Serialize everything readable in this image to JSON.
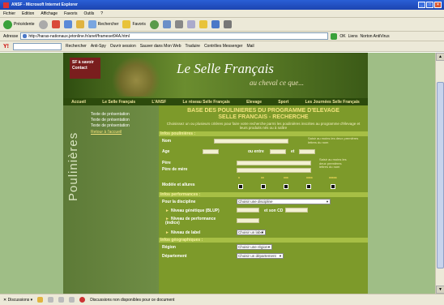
{
  "window": {
    "title": "ANSF - Microsoft Internet Explorer"
  },
  "menu": [
    "Fichier",
    "Edition",
    "Affichage",
    "Favoris",
    "Outils",
    "?"
  ],
  "toolbar": {
    "back": "Précédente",
    "search": "Rechercher",
    "favorites": "Favoris"
  },
  "address": {
    "label": "Adresse",
    "url": "http://haras-nationaux.jetonline.fr/anef/frameset94A.html",
    "go": "OK",
    "links": "Liens",
    "norton": "Norton AntiVirus"
  },
  "linksbar": {
    "search": "Rechercher",
    "antispy": "Anti-Spy",
    "session": "Ouvrir session",
    "save": "Sauver dans Mon Web",
    "translate": "Traduire",
    "parental": "Contrôles Messenger",
    "mail": "Mail"
  },
  "site": {
    "brand_tag": "SF à savoir",
    "contact": "Contact",
    "logo": "Le Selle Français",
    "tagline": "au cheval ce que...",
    "nav": [
      "Accueil",
      "Le Selle Français",
      "L'ANSF",
      "Le réseau Selle Français",
      "Elevage",
      "Sport",
      "Les Journées Selle Français"
    ],
    "side_title": "Poulinières",
    "side_links": [
      "Texte de présentation",
      "Texte de présentation",
      "Texte de présentation"
    ],
    "back_link": "Retour à l'accueil"
  },
  "form": {
    "title_line1": "BASE DES POULINIERES DU PROGRAMME D'ELEVAGE",
    "title_line2": "SELLE FRANCAIS - RECHERCHE",
    "intro": "Choisissez un ou plusieurs critères pour faire votre recherche parmi les poulinières inscrites au programme d'élevage et leurs produits nés ou à naître",
    "sec_poulinieres": "Infos poulinières :",
    "nom": "Nom",
    "nom_note": "Saisir au moins les deux premières lettres du nom",
    "age": "Age",
    "entre": "ou entre",
    "et": "et",
    "pere": "Père",
    "pere_mere": "Père de mère",
    "pere_note": "Saisir au moins les deux premières lettres du nom",
    "modele": "Modèle et allures",
    "stars": [
      "*",
      "**",
      "***",
      "****",
      "*****"
    ],
    "sec_performances": "Infos performances :",
    "discipline": "Pour la discipline",
    "discipline_value": "Choisir une discipline",
    "niveau_gen": "Niveau génétique (BLUP)",
    "et_cd": "et son CD",
    "niveau_perf": "Niveau de performance (indice)",
    "niveau_label": "Niveau de label",
    "label_value": "Choisir un label",
    "sec_geo": "Infos géographiques :",
    "region": "Région",
    "region_value": "Choisir une région",
    "departement": "Département",
    "departement_value": "Choisir un département"
  },
  "status": {
    "discussions": "Discussions",
    "text": "Discussions non disponibles pour ce document"
  }
}
